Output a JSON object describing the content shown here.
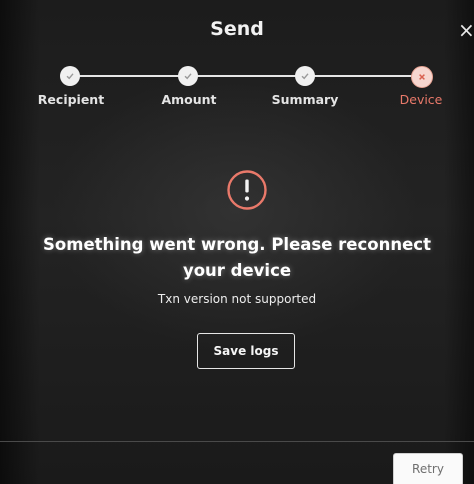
{
  "header": {
    "title": "Send",
    "close_glyph": "×"
  },
  "stepper": {
    "steps": [
      {
        "label": "Recipient",
        "status": "complete",
        "icon": "check-icon"
      },
      {
        "label": "Amount",
        "status": "complete",
        "icon": "check-icon"
      },
      {
        "label": "Summary",
        "status": "complete",
        "icon": "check-icon"
      },
      {
        "label": "Device",
        "status": "error",
        "icon": "x-icon"
      }
    ]
  },
  "error": {
    "icon": "alert-circle-icon",
    "title": "Something went wrong. Please reconnect your device",
    "detail": "Txn version not supported"
  },
  "actions": {
    "save_logs_label": "Save logs",
    "retry_label": "Retry"
  },
  "colors": {
    "error_accent": "#e9796a",
    "error_dot_fill": "#f7d6cf",
    "step_complete": "#f0f0f0",
    "background": "#1c1c1c"
  }
}
